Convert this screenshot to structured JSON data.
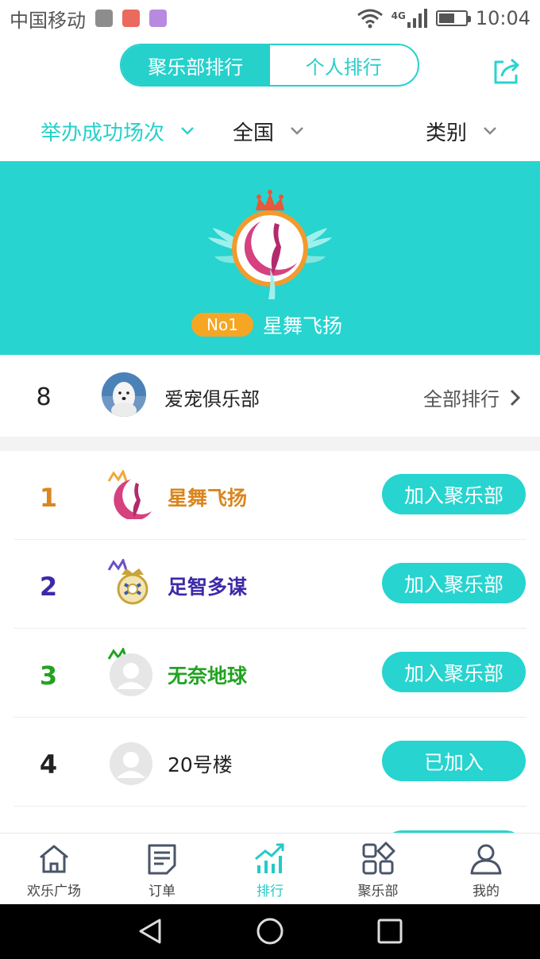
{
  "status_bar": {
    "carrier": "中国移动",
    "network": "4G",
    "time": "10:04",
    "battery_level": 0.55
  },
  "header": {
    "tabs": [
      {
        "label": "聚乐部排行",
        "active": true
      },
      {
        "label": "个人排行",
        "active": false
      }
    ]
  },
  "filters": {
    "metric": "举办成功场次",
    "region": "全国",
    "category": "类别"
  },
  "banner": {
    "badge": "No1",
    "club_name": "星舞飞扬"
  },
  "my_club": {
    "rank": "8",
    "name": "爱宠俱乐部",
    "all_link": "全部排行"
  },
  "ranking": [
    {
      "rank": "1",
      "name": "星舞飞扬",
      "action": "加入聚乐部"
    },
    {
      "rank": "2",
      "name": "足智多谋",
      "action": "加入聚乐部"
    },
    {
      "rank": "3",
      "name": "无奈地球",
      "action": "加入聚乐部"
    },
    {
      "rank": "4",
      "name": "20号楼",
      "action": "已加入"
    }
  ],
  "bottom_nav": [
    {
      "label": "欢乐广场",
      "icon": "home-icon"
    },
    {
      "label": "订单",
      "icon": "order-icon"
    },
    {
      "label": "排行",
      "icon": "chart-icon",
      "active": true
    },
    {
      "label": "聚乐部",
      "icon": "apps-icon"
    },
    {
      "label": "我的",
      "icon": "user-icon"
    }
  ],
  "colors": {
    "accent": "#27d4cf",
    "gold": "#d9861f",
    "purple": "#3d2aa8",
    "green": "#21a321",
    "badge": "#f6a623"
  }
}
